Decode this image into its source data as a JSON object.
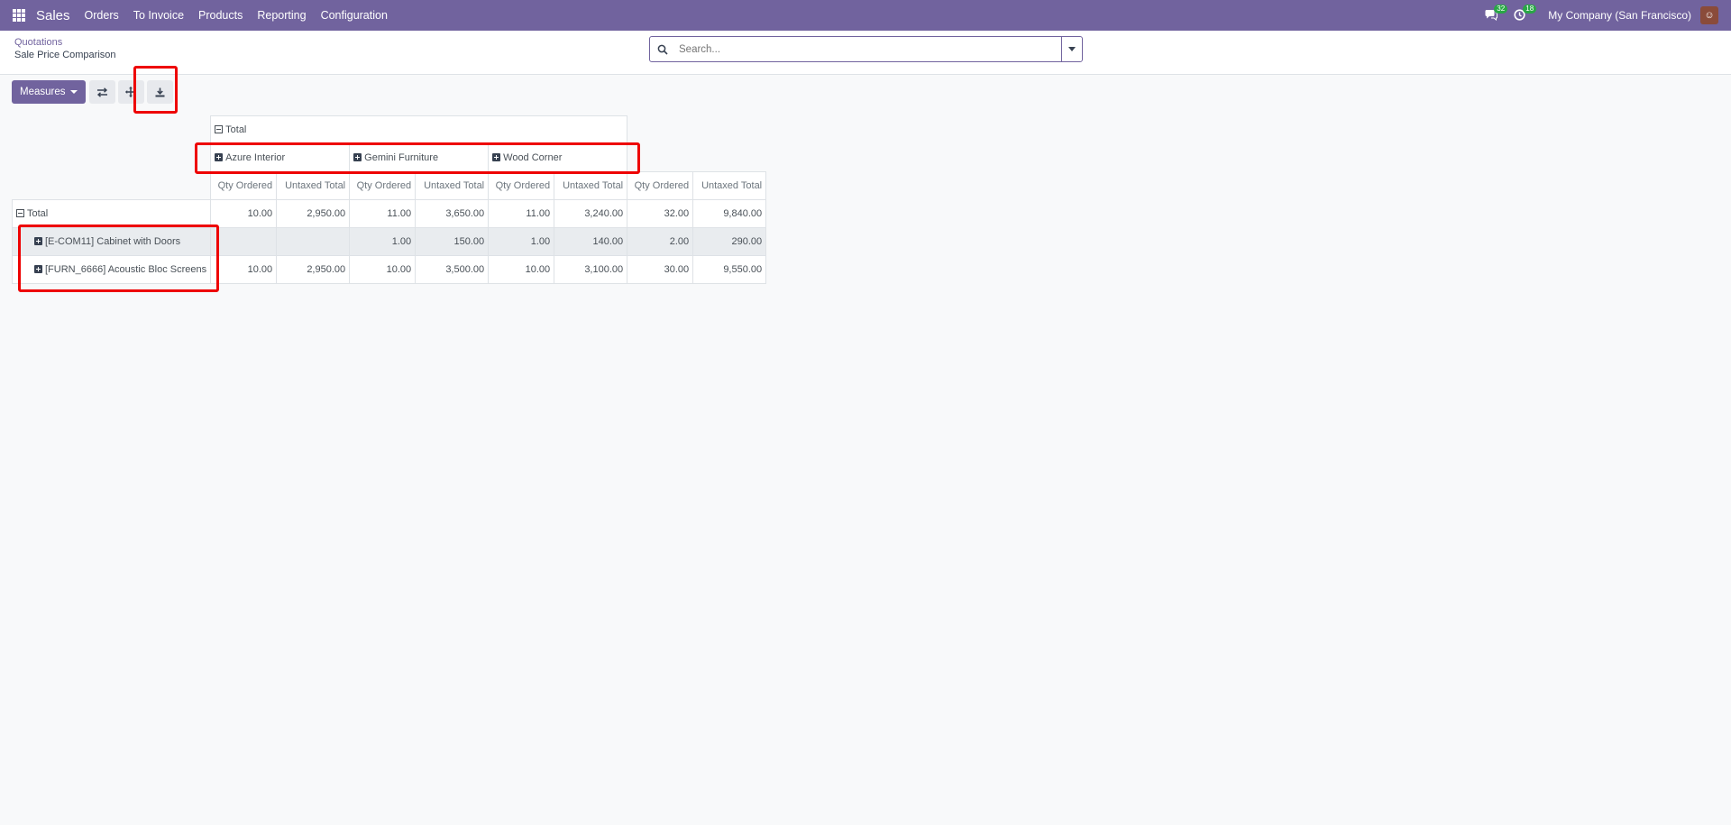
{
  "navbar": {
    "app_name": "Sales",
    "menu": [
      "Orders",
      "To Invoice",
      "Products",
      "Reporting",
      "Configuration"
    ],
    "messages_count": "32",
    "activities_count": "18",
    "company": "My Company (San Francisco)",
    "icons": [
      "apps-grid-icon",
      "chat-icon",
      "clock-icon",
      "avatar"
    ]
  },
  "breadcrumb": {
    "parent": "Quotations",
    "current": "Sale Price Comparison"
  },
  "search": {
    "placeholder": "Search..."
  },
  "toolbar": {
    "measures_label": "Measures",
    "icons": [
      "flip-axis-icon",
      "expand-all-icon",
      "download-icon"
    ]
  },
  "pivot": {
    "total_label": "Total",
    "columns": [
      "Azure Interior",
      "Gemini Furniture",
      "Wood Corner"
    ],
    "measures": [
      "Qty Ordered",
      "Untaxed Total"
    ],
    "rows": [
      {
        "label": "Total",
        "values": [
          "10.00",
          "2,950.00",
          "11.00",
          "3,650.00",
          "11.00",
          "3,240.00",
          "32.00",
          "9,840.00"
        ]
      },
      {
        "label": "[E-COM11] Cabinet with Doors",
        "values": [
          "",
          "",
          "1.00",
          "150.00",
          "1.00",
          "140.00",
          "2.00",
          "290.00"
        ]
      },
      {
        "label": "[FURN_6666] Acoustic Bloc Screens",
        "values": [
          "10.00",
          "2,950.00",
          "10.00",
          "3,500.00",
          "10.00",
          "3,100.00",
          "30.00",
          "9,550.00"
        ]
      }
    ]
  },
  "colors": {
    "brand": "#71639e",
    "highlight": "#ee0000"
  }
}
